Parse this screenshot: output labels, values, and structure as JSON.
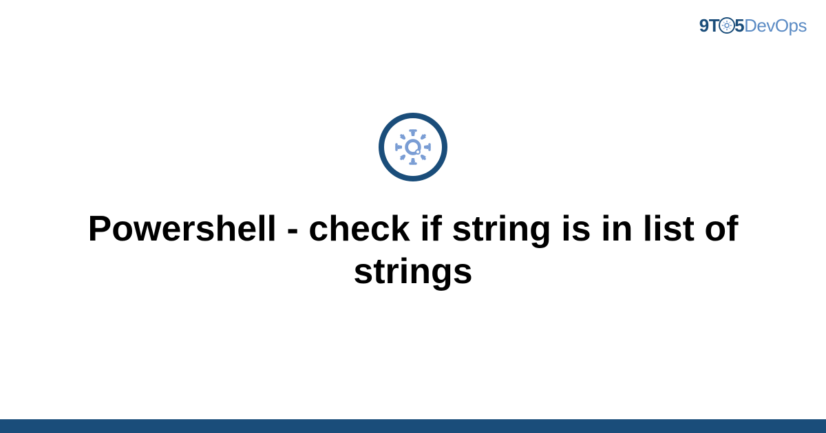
{
  "logo": {
    "part1": "9T",
    "part2": "5",
    "part3": "DevOps"
  },
  "title": "Powershell - check if string is in list of strings",
  "colors": {
    "primary": "#1a4d7a",
    "accent": "#5b8bc4",
    "gear_fill": "#7a9dd4"
  }
}
